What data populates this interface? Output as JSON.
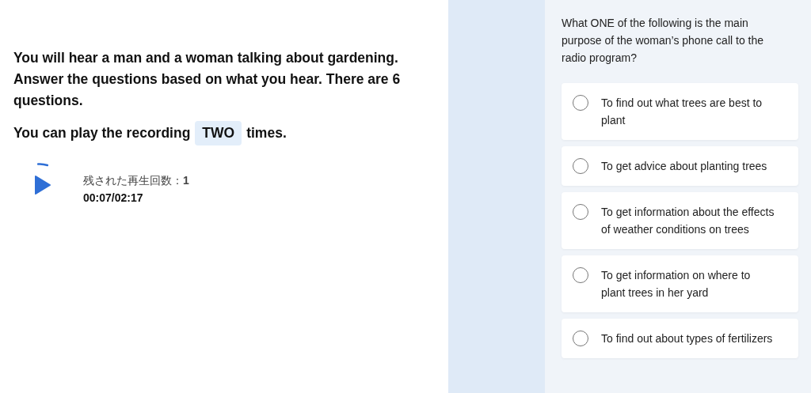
{
  "instructions": {
    "paragraph": "You will hear a man and a woman talking about gardening. Answer the questions based on what you hear. There are 6 questions.",
    "play_limit": {
      "before": "You can play the recording",
      "count": "TWO",
      "after": "times."
    }
  },
  "player": {
    "playing": false,
    "loading": true,
    "remaining_plays": "残された再生回数：**1**",
    "time": "00:07/02:17"
  },
  "question": {
    "text": "What ONE of the following is the main purpose of the woman’s phone call to the radio program?",
    "options": [
      {
        "label": "To find out what trees are best to plant",
        "selected": false
      },
      {
        "label": "To get advice about planting trees",
        "selected": false
      },
      {
        "label": "To get information about the effects of weather conditions on trees",
        "selected": false
      },
      {
        "label": "To get information on where to plant trees in her yard",
        "selected": false
      },
      {
        "label": "To find out about types of fertilizers",
        "selected": false
      }
    ]
  }
}
